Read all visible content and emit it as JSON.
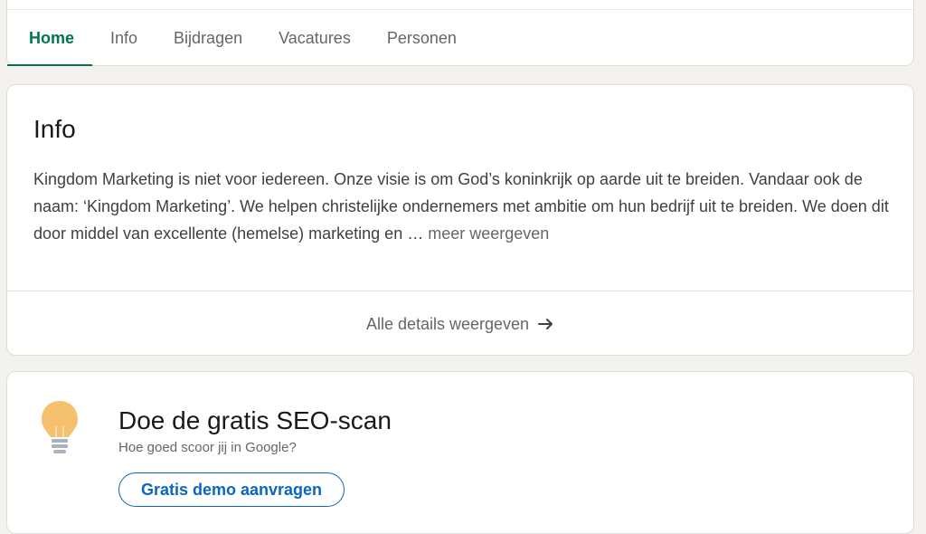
{
  "tabs": [
    {
      "label": "Home",
      "active": true
    },
    {
      "label": "Info"
    },
    {
      "label": "Bijdragen"
    },
    {
      "label": "Vacatures"
    },
    {
      "label": "Personen"
    }
  ],
  "info": {
    "title": "Info",
    "description": "Kingdom Marketing is niet voor iedereen. Onze visie is om God’s koninkrijk op aarde uit te breiden. Vandaar ook de naam: ‘Kingdom Marketing’. We helpen christelijke ondernemers met ambitie om hun bedrijf uit te breiden. We doen dit door middel van excellente (hemelse) marketing en …",
    "more_label": "meer weergeven",
    "details_label": "Alle details weergeven",
    "details_icon": "arrow-right-icon"
  },
  "promo": {
    "icon": "lightbulb-icon",
    "title": "Doe de gratis SEO-scan",
    "subtitle": "Hoe goed scoor jij in Google?",
    "button_label": "Gratis demo aanvragen"
  },
  "colors": {
    "accent_green": "#01754f",
    "link_blue": "#0a66c2",
    "page_bg": "#f4f2ee",
    "bulb_yellow": "#f5c16c"
  }
}
